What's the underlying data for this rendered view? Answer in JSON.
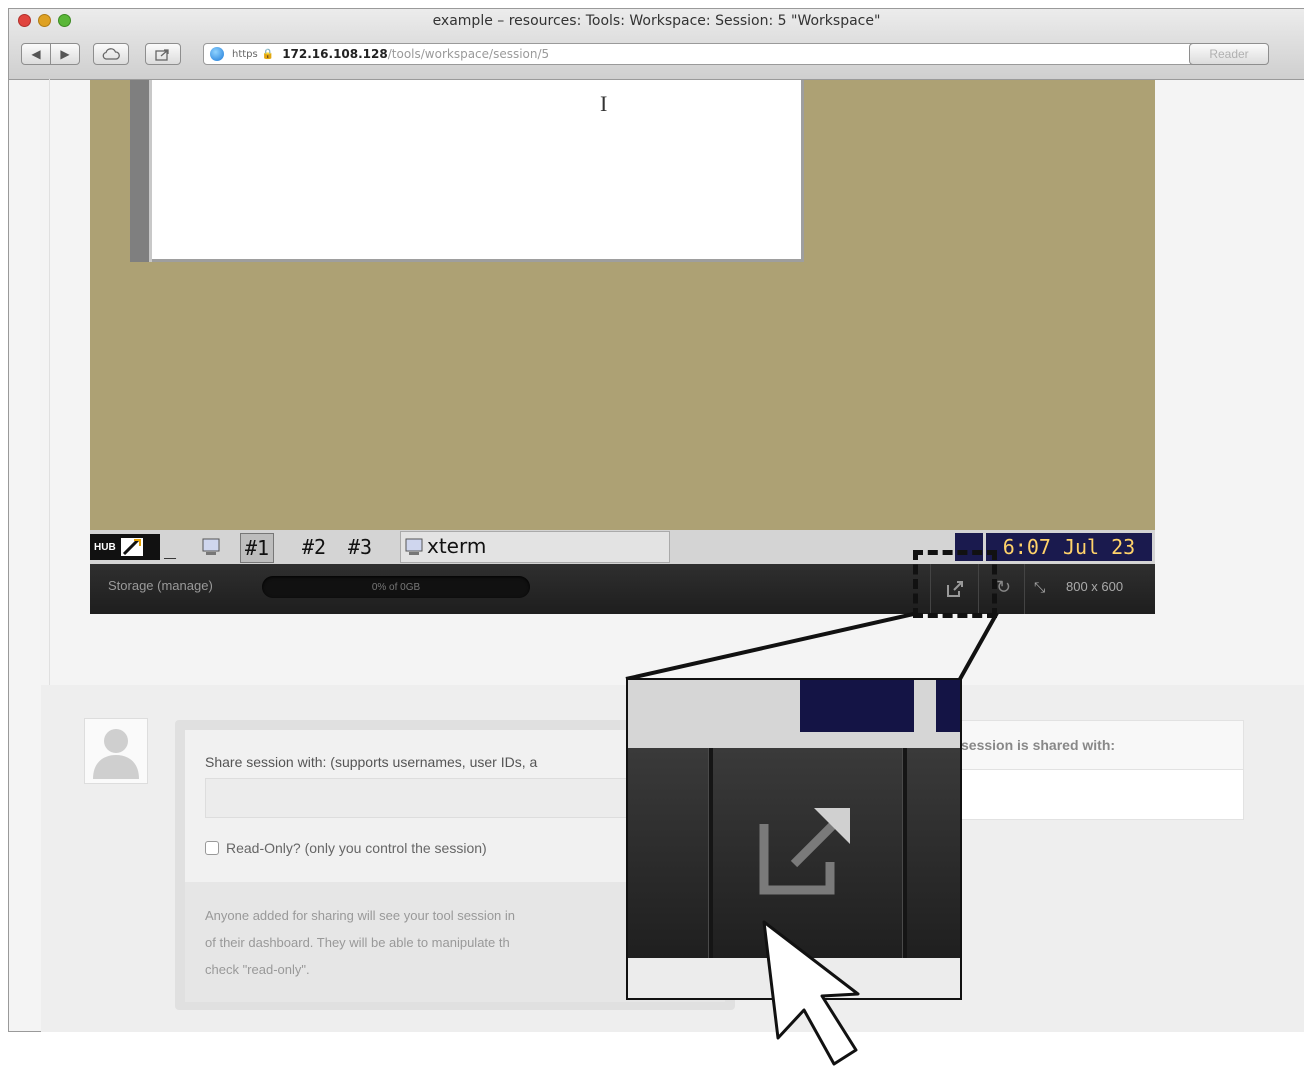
{
  "window": {
    "title": "example – resources: Tools: Workspace: Session: 5 \"Workspace\""
  },
  "toolbar": {
    "back_label": "◀",
    "forward_label": "▶",
    "reader_label": "Reader",
    "url_scheme": "https",
    "url_host": "172.16.108.128",
    "url_path": "/tools/workspace/session/5"
  },
  "taskbar": {
    "logo_text": "HUB",
    "minimize_glyph": "_",
    "desktops": [
      "#1",
      "#2",
      "#3"
    ],
    "window_task_label": "xterm",
    "clock": "6:07 Jul 23"
  },
  "control_bar": {
    "storage_label": "Storage (manage)",
    "storage_value": "0% of 0GB",
    "resolution": "800 x 600"
  },
  "share": {
    "label": "Share session with: (supports usernames, user IDs, a",
    "readonly_label": "Read-Only? (only you control the session)",
    "note_lines": [
      "Anyone added for sharing will see your tool session in",
      "of their dashboard. They will be able to manipulate th",
      "check \"read-only\"."
    ],
    "shared_with_label": "session is shared with:"
  },
  "icons": {
    "popout": "popout-window-icon",
    "refresh": "refresh-icon",
    "resize": "resize-arrows-icon",
    "avatar": "user-avatar-icon",
    "cursor": "mouse-pointer-icon"
  }
}
